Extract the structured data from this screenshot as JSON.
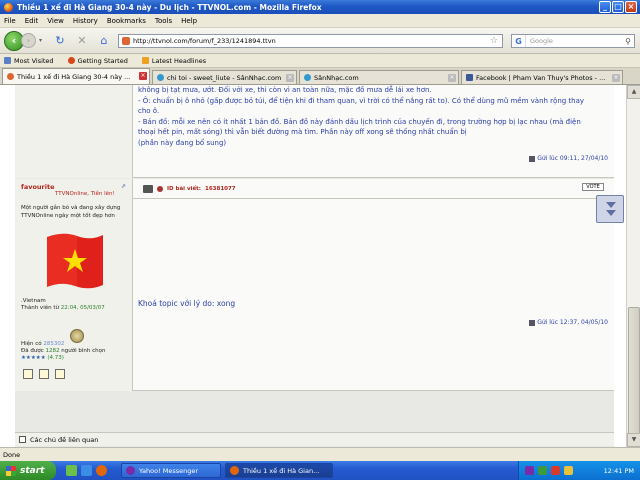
{
  "window": {
    "title": "Thiều 1 xế đi Hà Giang 30-4 này - Du lịch - TTVNOL.com - Mozilla Firefox"
  },
  "menu": [
    "File",
    "Edit",
    "View",
    "History",
    "Bookmarks",
    "Tools",
    "Help"
  ],
  "nav": {
    "url": "http://ttvnol.com/forum/f_233/1241894.ttvn",
    "search_placeholder": "Google"
  },
  "bookmarks": [
    "Most Visited",
    "Getting Started",
    "Latest Headlines"
  ],
  "tabs": [
    {
      "label": "Thiều 1 xế đi Hà Giang 30-4 này ...",
      "active": true
    },
    {
      "label": "chi toi - sweet_liute - SânNhạc.com",
      "active": false
    },
    {
      "label": "SânNhạc.com",
      "active": false
    },
    {
      "label": "Facebook | Pham Van Thuy's Photos - ...",
      "active": false
    }
  ],
  "post1": {
    "lines": [
      "không bị tạt mưa, ướt. Đối với xe, thì còn vì an toàn nữa, mặc đồ mưa dễ lái xe hơn.",
      "- Ô: chuẩn bị ô nhỏ (gấp được bỏ túi, để tiện khi đi tham quan, vì trời có thể nắng rất to). Có thể dùng mũ mềm vành rộng thay",
      "cho ô.",
      "- Bản đồ: mỗi xe nên có ít nhất 1 bản đồ. Bản đồ này đánh dấu lịch trình của chuyến đi, trong trường hợp bị lạc nhau (mà điện",
      "thoại hết pin, mất sóng) thì vẫn biết đường mà tìm. Phần này off xong sẽ thống nhất chuẩn bị",
      "(phần này đang bổ sung)"
    ],
    "meta": "Gửi lúc 09:11, 27/04/10"
  },
  "post2": {
    "username": "favourite",
    "rank": "TTVNOnline, Tiền lên!",
    "signature": "Một người gắn bó và đang xây dựng TTVNOnline ngày một tốt đẹp hơn",
    "country": ".Vietnam",
    "member_since_label": "Thành viên từ",
    "member_since": "22:04, 05/03/07",
    "posts_label": "Hiện có",
    "posts": "285302",
    "thanks_label": "Đã được",
    "thanks_count": "1282",
    "thanks_suffix": "người bình chọn",
    "rating": "★★★★★",
    "rating_value": "(4.73)",
    "id_label": "ID bài viết:",
    "id_value": "16381077",
    "vote": "VOTE",
    "message": "Khoá topic với lý do: xong",
    "meta": "Gửi lúc 12:37, 04/05/10"
  },
  "related": "Các chủ đề liên quan",
  "status": "Done",
  "taskbar": {
    "start": "start",
    "tasks": [
      "Yahoo! Messenger",
      "Thiều 1 xế đi Hà Gian..."
    ],
    "clock": "12:41 PM"
  }
}
